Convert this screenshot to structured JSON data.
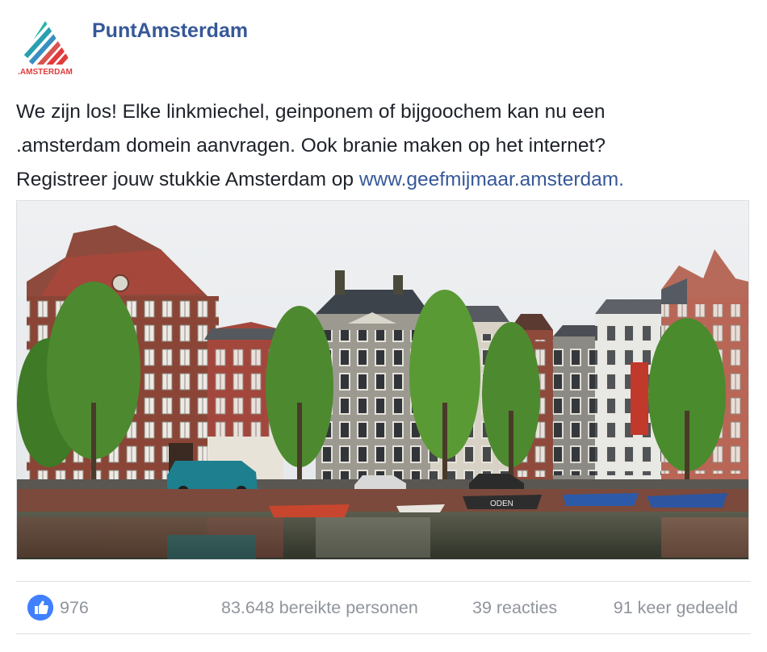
{
  "page": {
    "name": "PuntAmsterdam",
    "logo_text": ".AMSTERDAM"
  },
  "post": {
    "message_lines": [
      "We zijn los! Elke linkmiechel, geinponem of bijgoochem kan nu een",
      ".amsterdam domein aanvragen. Ook branie maken op het internet?",
      "Registreer jouw stukkie Amsterdam op "
    ],
    "link_text": "www.geefmijmaar.amsterdam."
  },
  "photo": {
    "image_icon": "canal-houses-photo"
  },
  "stats": {
    "like_icon": "thumbs-up-icon",
    "likes": "976",
    "reach": "83.648 bereikte personen",
    "reactions": "39 reacties",
    "shares": "91 keer gedeeld"
  },
  "colors": {
    "page_name": "#365899",
    "link": "#365899",
    "muted_text": "#90949c",
    "like_blue": "#4080ff",
    "divider": "#dddfe2"
  }
}
